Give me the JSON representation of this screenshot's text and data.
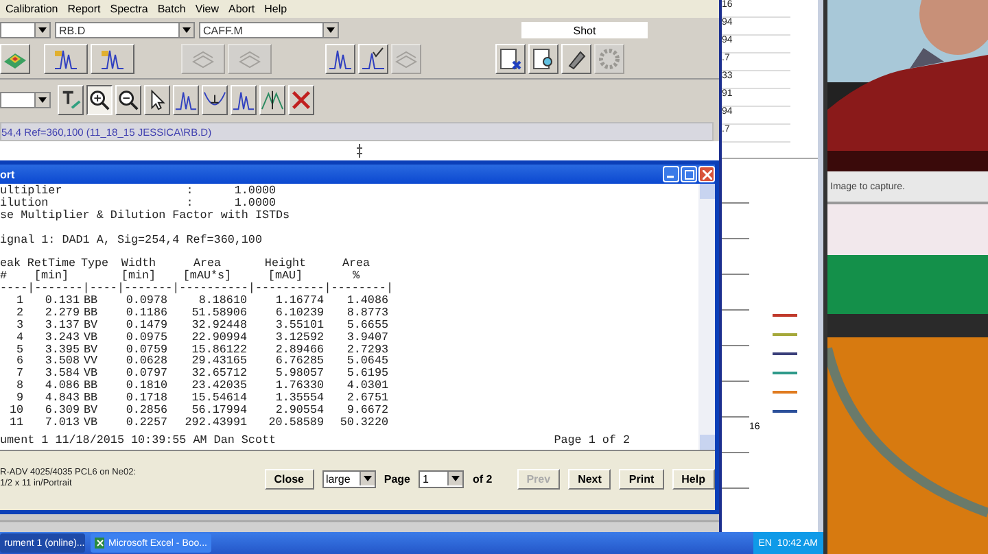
{
  "menu": [
    "Calibration",
    "Report",
    "Spectra",
    "Batch",
    "View",
    "Abort",
    "Help"
  ],
  "file_fields": [
    {
      "value": "RB.D"
    },
    {
      "value": "CAFF.M"
    }
  ],
  "shot_field": {
    "value": "Shot"
  },
  "toolbar_top": [
    {
      "kind": "surface",
      "disabled": false
    },
    {
      "kind": "load-signal",
      "disabled": false
    },
    {
      "kind": "load-overlay",
      "disabled": false
    },
    {
      "kind": "method-a",
      "disabled": true
    },
    {
      "kind": "method-b",
      "disabled": true
    },
    {
      "kind": "integrate",
      "disabled": false
    },
    {
      "kind": "calibrate",
      "disabled": false
    },
    {
      "kind": "grid",
      "disabled": true
    },
    {
      "kind": "report-delete",
      "disabled": false
    },
    {
      "kind": "report-preview",
      "disabled": false
    },
    {
      "kind": "tool",
      "disabled": false
    },
    {
      "kind": "gear",
      "disabled": true
    }
  ],
  "toolbar_bottom": [
    {
      "kind": "text",
      "pressed": false
    },
    {
      "kind": "zoom-in",
      "pressed": true
    },
    {
      "kind": "zoom-out",
      "pressed": false
    },
    {
      "kind": "pointer",
      "pressed": false
    },
    {
      "kind": "integrate",
      "pressed": false
    },
    {
      "kind": "baseline",
      "pressed": false
    },
    {
      "kind": "peaks",
      "pressed": false
    },
    {
      "kind": "split",
      "pressed": false
    },
    {
      "kind": "delete",
      "pressed": false
    }
  ],
  "signal_line": "54,4 Ref=360,100 (11_18_15 JESSICA\\RB.D)",
  "report": {
    "title": "ort",
    "settings": [
      "ultiplier                  :      1.0000",
      "ilution                    :      1.0000",
      "se Multiplier & Dilution Factor with ISTDs"
    ],
    "signal_title": "ignal 1: DAD1 A, Sig=254,4 Ref=360,100",
    "columns": [
      {
        "title": "eak",
        "unit": "#"
      },
      {
        "title": "RetTime",
        "unit": "[min]"
      },
      {
        "title": "Type"
      },
      {
        "title": "Width",
        "unit": "[min]"
      },
      {
        "title": "Area",
        "unit": "[mAU*s]"
      },
      {
        "title": "Height",
        "unit": "[mAU]"
      },
      {
        "title": "Area",
        "unit": "%"
      }
    ],
    "rule": "----|-------|----|-------|----------|----------|--------|",
    "rows": [
      [
        "1",
        "0.131",
        "BB",
        "0.0978",
        "8.18610",
        "1.16774",
        "1.4086"
      ],
      [
        "2",
        "2.279",
        "BB",
        "0.1186",
        "51.58906",
        "6.10239",
        "8.8773"
      ],
      [
        "3",
        "3.137",
        "BV",
        "0.1479",
        "32.92448",
        "3.55101",
        "5.6655"
      ],
      [
        "4",
        "3.243",
        "VB",
        "0.0975",
        "22.90994",
        "3.12592",
        "3.9407"
      ],
      [
        "5",
        "3.395",
        "BV",
        "0.0759",
        "15.86122",
        "2.89466",
        "2.7293"
      ],
      [
        "6",
        "3.508",
        "VV",
        "0.0628",
        "29.43165",
        "6.76285",
        "5.0645"
      ],
      [
        "7",
        "3.584",
        "VB",
        "0.0797",
        "32.65712",
        "5.98057",
        "5.6195"
      ],
      [
        "8",
        "4.086",
        "BB",
        "0.1810",
        "23.42035",
        "1.76330",
        "4.0301"
      ],
      [
        "9",
        "4.843",
        "BB",
        "0.1718",
        "15.54614",
        "1.35554",
        "2.6751"
      ],
      [
        "10",
        "6.309",
        "BV",
        "0.2856",
        "56.17994",
        "2.90554",
        "9.6672"
      ],
      [
        "11",
        "7.013",
        "VB",
        "0.2257",
        "292.43991",
        "20.58589",
        "50.3220"
      ]
    ],
    "footer_left": "ument 1 11/18/2015 10:39:55 AM Dan Scott",
    "footer_right": "Page 1 of 2"
  },
  "print_bar": {
    "printer": "R-ADV 4025/4035 PCL6 on Ne02:",
    "paper": "1/2 x 11 in/Portrait",
    "close": "Close",
    "size": "large",
    "page_label": "Page",
    "page": "1",
    "of": "of 2",
    "buttons": [
      {
        "label": "Prev",
        "disabled": true
      },
      {
        "label": "Next",
        "disabled": false
      },
      {
        "label": "Print",
        "disabled": false
      },
      {
        "label": "Help",
        "disabled": false
      }
    ]
  },
  "excel": {
    "cells": [
      "16",
      "94",
      "94",
      ".7",
      "33",
      "91",
      "94",
      ".7"
    ],
    "axis_label": "16",
    "legend": [
      {
        "color": "#c0392b"
      },
      {
        "color": "#a5a83a"
      },
      {
        "color": "#3a3f7a"
      },
      {
        "color": "#2f9a8a"
      },
      {
        "color": "#e07b20"
      },
      {
        "color": "#2b4f9a"
      }
    ]
  },
  "capture_hint": "Image to capture.",
  "taskbar": {
    "items": [
      {
        "label": "rument 1 (online)...",
        "selected": true
      },
      {
        "label": "Microsoft Excel - Boo...",
        "selected": false
      }
    ],
    "lang": "EN",
    "time": "10:42 AM"
  }
}
